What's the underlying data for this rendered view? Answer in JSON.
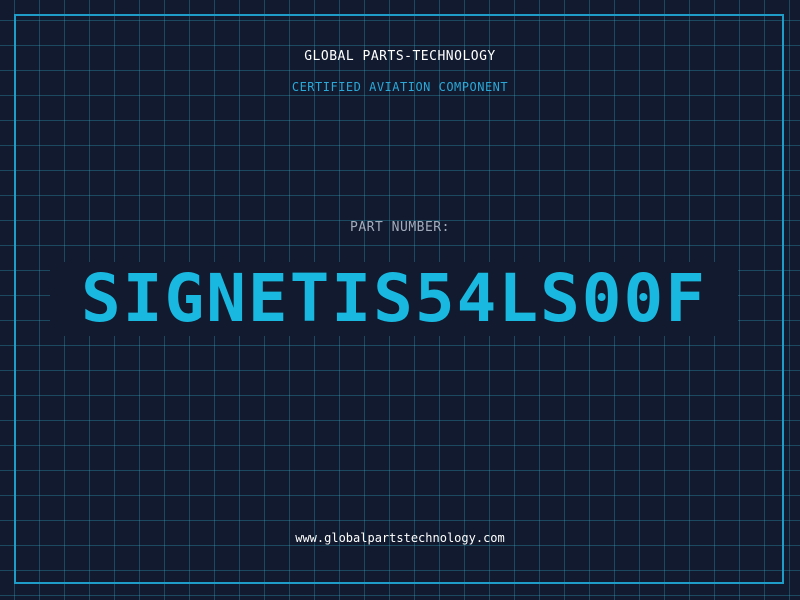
{
  "header": {
    "company": "GLOBAL PARTS-TECHNOLOGY",
    "subtitle": "CERTIFIED AVIATION COMPONENT"
  },
  "part": {
    "label": "PART NUMBER:",
    "number": "SIGNETIS54LS00F"
  },
  "footer": {
    "url": "www.globalpartstechnology.com"
  },
  "colors": {
    "background": "#111a2e",
    "grid": "#34a0be",
    "accent": "#18b8e0",
    "frame": "#1f9cc7"
  }
}
